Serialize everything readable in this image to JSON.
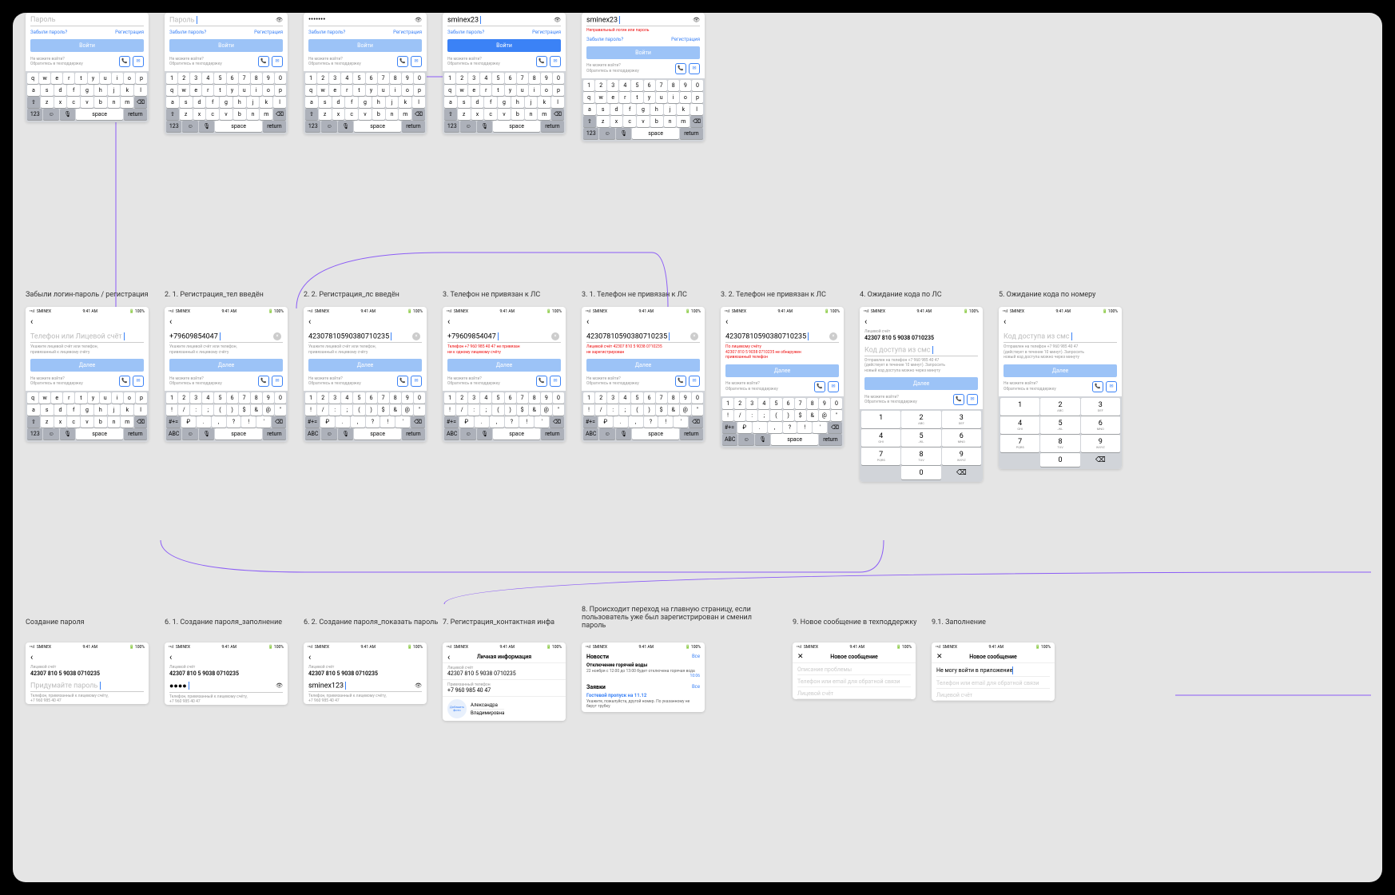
{
  "status": {
    "carrier": "SMINEX",
    "time": "9:41 AM",
    "batt": "100%",
    "sig": "••ıl"
  },
  "common": {
    "pass_label": "Пароль",
    "forgot": "Забыли пароль?",
    "reg": "Регистрация",
    "login": "Войти",
    "support1": "Не можете войти?",
    "support2": "Обратитесь в техподдержку",
    "next": "Далее",
    "hint_ls": "Укажите лицевой счёт или телефон,\nпривязанный к лицевому счёту",
    "space": "space",
    "return": "return"
  },
  "kbd": {
    "numrow": [
      "1",
      "2",
      "3",
      "4",
      "5",
      "6",
      "7",
      "8",
      "9",
      "0"
    ],
    "qrow": [
      "q",
      "w",
      "e",
      "r",
      "t",
      "y",
      "u",
      "i",
      "o",
      "p"
    ],
    "arow": [
      "a",
      "s",
      "d",
      "f",
      "g",
      "h",
      "j",
      "k",
      "l"
    ],
    "zrow": [
      "z",
      "x",
      "c",
      "v",
      "b",
      "n",
      "m"
    ],
    "sym1": [
      "!",
      "/",
      ":",
      ";",
      "(",
      ")",
      "$",
      "&",
      "@",
      "\""
    ],
    "sym2": [
      "₽",
      ".",
      ",",
      "?",
      "!",
      "'"
    ],
    "abc": "ABC",
    "n123": "123",
    "shift": "⇧",
    "del": "⌫",
    "globe": "🌐",
    "mic": "🎙",
    "smile": "☺",
    "hash": "#+="
  },
  "numpad": {
    "keys": [
      [
        "1",
        ""
      ],
      [
        "2",
        "ABC"
      ],
      [
        "3",
        "DEF"
      ],
      [
        "4",
        "GHI"
      ],
      [
        "5",
        "JKL"
      ],
      [
        "6",
        "MNO"
      ],
      [
        "7",
        "PQRS"
      ],
      [
        "8",
        "TUV"
      ],
      [
        "9",
        "WXYZ"
      ],
      [
        "",
        "​"
      ],
      [
        "0",
        ""
      ],
      [
        "⌫",
        ""
      ]
    ]
  },
  "row0": [
    {
      "val": "",
      "dots": false,
      "eye": false,
      "err": ""
    },
    {
      "val": "",
      "dots": false,
      "eye": true,
      "err": "",
      "caret": true
    },
    {
      "val": "•••••••",
      "dots": false,
      "eye": true,
      "err": ""
    },
    {
      "val": "sminex23",
      "dots": false,
      "eye": true,
      "err": "",
      "caret": true,
      "active": true
    },
    {
      "val": "sminex23",
      "dots": false,
      "eye": true,
      "err": "Неправильный логин или пароль",
      "caret": true
    }
  ],
  "titles": {
    "r1_0": "Забыли логин-пароль / регистрация",
    "r1_1": "2. 1. Регистрация_тел введён",
    "r1_2": "2. 2. Регистрация_лс введён",
    "r1_3": "3. Телефон не привязан к ЛС",
    "r1_4": "3. 1. Телефон не привязан к ЛС",
    "r1_5": "3. 2. Телефон не привязан к ЛС",
    "r1_6": "4. Ожидание кода по ЛС",
    "r1_7": "5. Ожидание кода по номеру",
    "r2_0": "Создание пароля",
    "r2_1": "6. 1. Создание пароля_заполнение",
    "r2_2": "6. 2. Создание пароля_показать пароль",
    "r2_3": "7. Регистрация_контактная инфа",
    "r2_4": "8. Происходит переход на главную страницу, если пользователь уже был зарегистрирован и сменил пароль",
    "r2_5": "9. Новое сообщение в техподдержку",
    "r2_6": "9.1. Заполнение"
  },
  "row1": {
    "s0": {
      "val": "Телефон или Лицевой счёт",
      "ph": true
    },
    "s1": {
      "val": "+79609854047"
    },
    "s2": {
      "val": "42307810590380710235"
    },
    "s3": {
      "val": "+79609854047",
      "err": "Телефон +7 960 985 40 47 не привязан\nни к одному лицевому счёту"
    },
    "s4": {
      "val": "42307810590380710235",
      "err": "Лицевой счёт 42307 810 5 9038 0710235\nне зарегистрирован"
    },
    "s5": {
      "val": "42307810590380710235",
      "err": "По лицевому счёту\n42307 810 5 9038 0710235 не обнаружен\nпривязанный телефон"
    },
    "s6": {
      "lbl": "Лицевой счёт",
      "acc": "42307 810 5 9038 0710235",
      "ph": "Код доступа из смс",
      "hint": "Отправлен на телефон +7 960 985 40 47\n(действует в течение 10 минут). Запросить\nновый код доступа можно через минуту"
    },
    "s7": {
      "ph": "Код доступа из смс",
      "hint": "Отправлен на телефон +7 960 985 40 47\n(действует в течение 10 минут). Запросить\nновый код доступа можно через минуту"
    }
  },
  "row2": {
    "s0": {
      "lbl": "Лицевой счёт",
      "acc": "42307 810 5 9038 0710235",
      "ph": "Придумайте пароль",
      "hint": "Телефон, привязанный к лицевому счёту,\n+7 960 985 40 47"
    },
    "s1": {
      "lbl": "Лицевой счёт",
      "acc": "42307 810 5 9038 0710235",
      "val": "●●●●",
      "hint": "Телефон, привязанный к лицевому счёту,\n+7 960 985 40 47"
    },
    "s2": {
      "lbl": "Лицевой счёт",
      "acc": "42307 810 5 9038 0710235",
      "val": "sminex123",
      "hint": "Телефон, привязанный к лицевому счёту,\n+7 960 985 40 47"
    },
    "s3": {
      "title": "Личная информация",
      "r1l": "Лицевой счёт",
      "r1v": "42307 810 5 9038 0710235",
      "r2l": "Привязанный телефон",
      "r2v": "+7 960 985 40 47",
      "avatar": "Добавить\nфото",
      "name1": "Александра",
      "name2": "Владимировна"
    },
    "s4": {
      "news": "Новости",
      "all": "Все",
      "n1t": "Отключение горячей воды",
      "n1b": "22 ноября с 12:00 до 13:00 будет отключена горячая вода",
      "n1time": "10:06",
      "req": "Заявки",
      "n2t": "Гостевой пропуск на 11.12",
      "n2b": "Укажите, пожалуйста, другой номер. По указанному не берут трубку"
    },
    "s5": {
      "title": "Новое сообщение",
      "f1": "Описание проблемы",
      "f2": "Телефон или email для обратной связи",
      "f3": "Лицевой счёт"
    },
    "s6": {
      "title": "Новое сообщение",
      "f1": "Не могу войти в приложение",
      "f2": "Телефон или email для обратной связи",
      "f3": "Лицевой счёт"
    }
  }
}
